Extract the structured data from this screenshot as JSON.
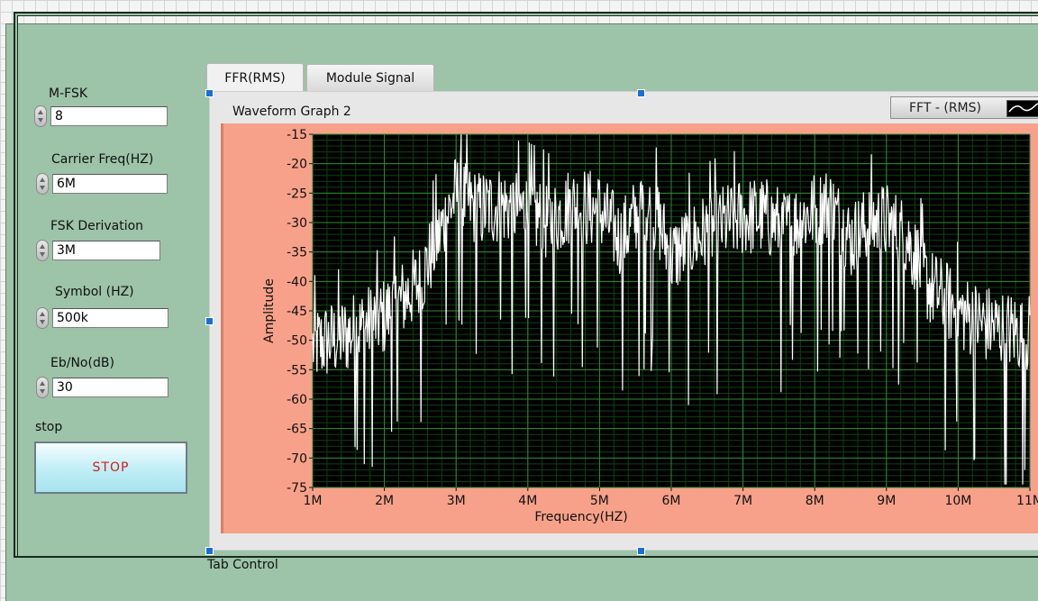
{
  "controls": [
    {
      "id": "m-fsk",
      "label": "M-FSK",
      "value": "8"
    },
    {
      "id": "carrier-freq",
      "label": "Carrier Freq(HZ)",
      "value": "6M"
    },
    {
      "id": "fsk-derivation",
      "label": "FSK Derivation",
      "value": "3M"
    },
    {
      "id": "symbol",
      "label": "Symbol (HZ)",
      "value": "500k"
    },
    {
      "id": "eb-no",
      "label": "Eb/No(dB)",
      "value": "30"
    }
  ],
  "stop": {
    "label": "stop",
    "button_label": "STOP"
  },
  "tabs": [
    {
      "label": "FFR(RMS)",
      "active": true
    },
    {
      "label": "Module Signal",
      "active": false
    }
  ],
  "tab_control_label": "Tab Control",
  "graph": {
    "title": "Waveform Graph 2",
    "legend_label": "FFT - (RMS)"
  },
  "chart_data": {
    "type": "line",
    "xlabel": "Frequency(HZ)",
    "ylabel": "Amplitude",
    "xlim": [
      1,
      11
    ],
    "ylim": [
      -75,
      -15
    ],
    "x_tick_labels": [
      "1M",
      "2M",
      "3M",
      "4M",
      "5M",
      "6M",
      "7M",
      "8M",
      "9M",
      "10M",
      "11M"
    ],
    "y_tick_labels": [
      "-15",
      "-20",
      "-25",
      "-30",
      "-35",
      "-40",
      "-45",
      "-50",
      "-55",
      "-60",
      "-65",
      "-70",
      "-75"
    ],
    "grid": true,
    "colors": {
      "plot_bg": "#000000",
      "grid_major": "#2f8a32",
      "grid_minor": "#0f4013",
      "trace": "#ffffff",
      "frame": "#f7a18a"
    },
    "series": [
      {
        "name": "FFT - (RMS)",
        "envelope_x": [
          1.0,
          1.5,
          2.0,
          2.5,
          2.8,
          3.0,
          3.3,
          3.6,
          4.0,
          4.3,
          4.6,
          5.0,
          5.3,
          5.6,
          5.8,
          6.0,
          6.3,
          6.6,
          7.0,
          7.3,
          7.6,
          8.0,
          8.2,
          8.5,
          8.8,
          9.0,
          9.3,
          9.6,
          10.0,
          10.3,
          10.6,
          11.0
        ],
        "envelope_y": [
          -51,
          -49,
          -46,
          -40,
          -31,
          -25,
          -28,
          -27,
          -28,
          -30,
          -27,
          -28,
          -33,
          -27,
          -29,
          -36,
          -33,
          -31,
          -29,
          -29,
          -31,
          -28,
          -27,
          -33,
          -30,
          -30,
          -33,
          -41,
          -45,
          -47,
          -48,
          -49
        ]
      }
    ]
  }
}
